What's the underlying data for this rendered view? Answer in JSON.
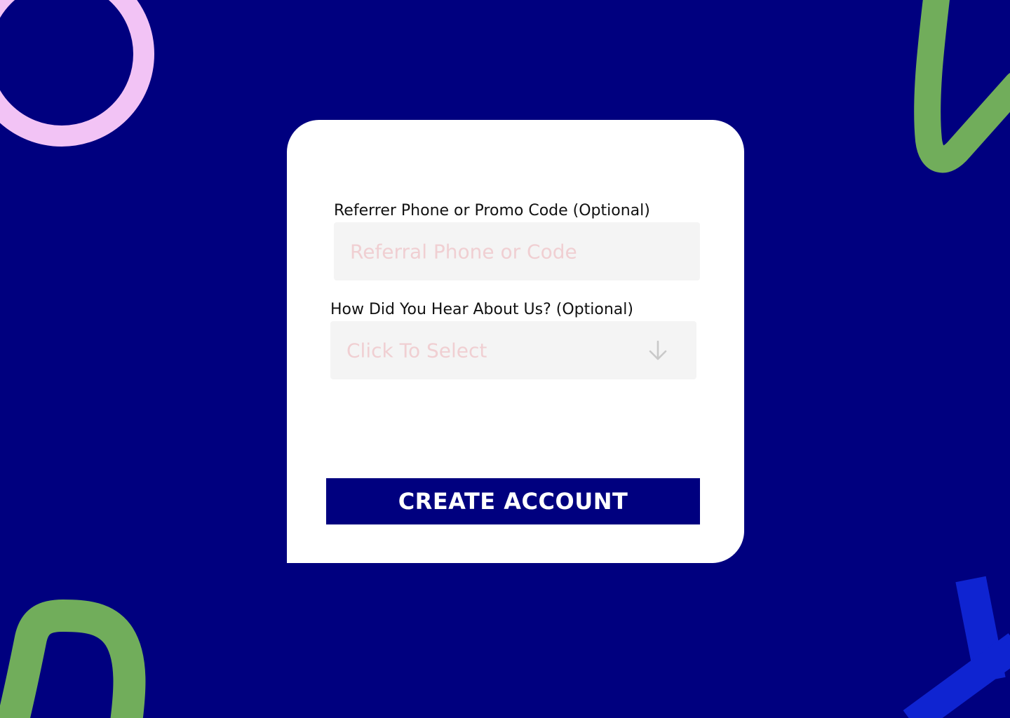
{
  "form": {
    "referrer": {
      "label": "Referrer Phone or Promo Code (Optional)",
      "placeholder": "Referral Phone or Code",
      "value": ""
    },
    "hear_about": {
      "label": "How Did You Hear About Us? (Optional)",
      "placeholder": "Click To Select",
      "icon": "arrow-down-icon"
    },
    "submit_label": "CREATE ACCOUNT"
  },
  "colors": {
    "background": "#00007f",
    "card": "#ffffff",
    "field_bg": "#f4f4f4",
    "placeholder": "#f0cfd2",
    "button": "#00007f",
    "button_text": "#ffffff",
    "deco_pink": "#f2c3f5",
    "deco_green": "#71ad5b",
    "deco_blue": "#0f24d1"
  }
}
